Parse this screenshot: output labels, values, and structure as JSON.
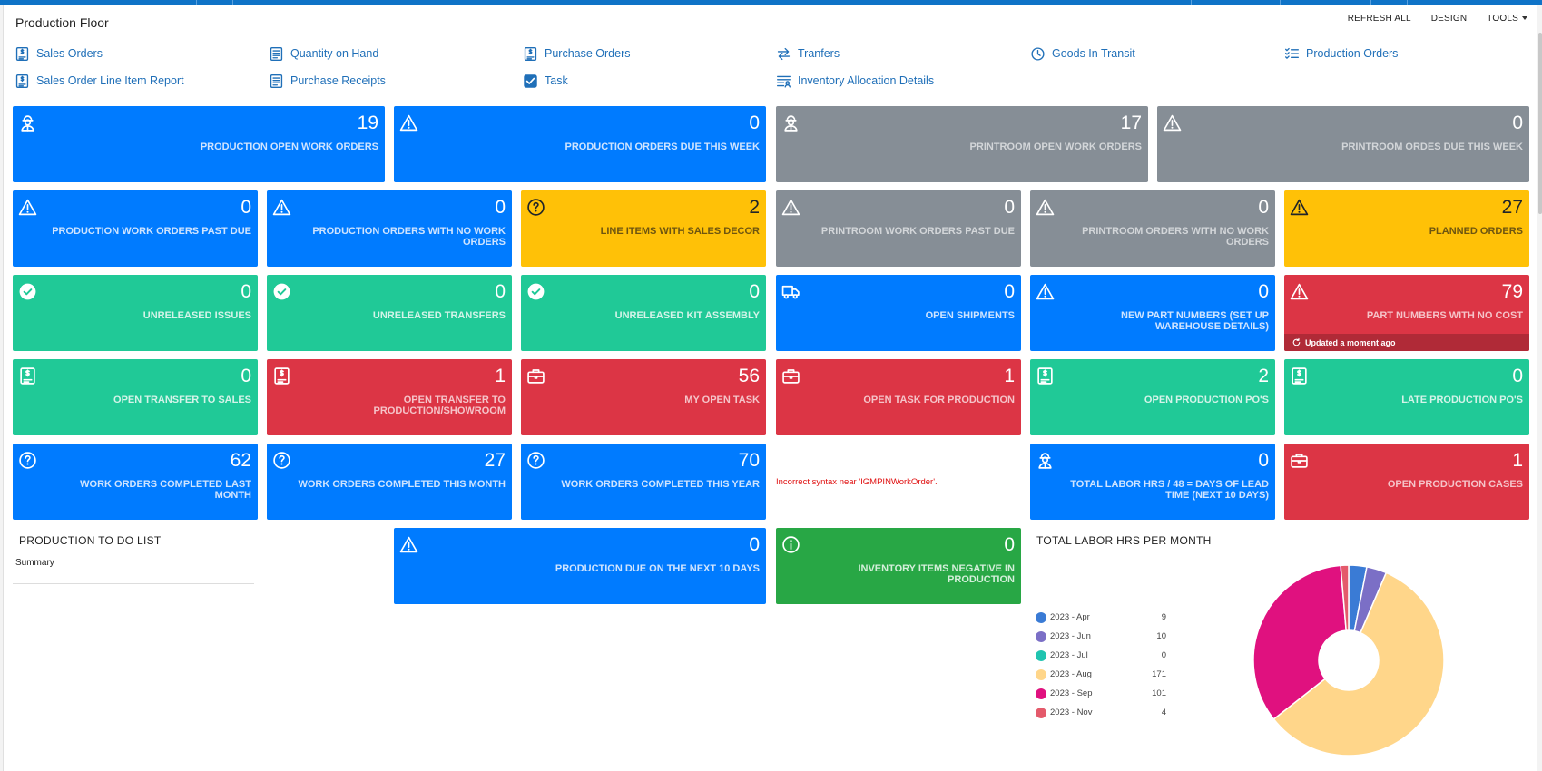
{
  "page": {
    "title": "Production Floor"
  },
  "toolbar": {
    "refresh": "REFRESH ALL",
    "design": "DESIGN",
    "tools": "TOOLS"
  },
  "links": [
    {
      "label": "Sales Orders",
      "icon": "document-dollar-icon"
    },
    {
      "label": "Quantity on Hand",
      "icon": "document-list-icon"
    },
    {
      "label": "Purchase Orders",
      "icon": "document-dollar-icon"
    },
    {
      "label": "Tranfers",
      "icon": "arrows-exchange-icon"
    },
    {
      "label": "Goods In Transit",
      "icon": "clock-icon"
    },
    {
      "label": "Production Orders",
      "icon": "checklist-icon"
    },
    {
      "label": "Sales Order Line Item Report",
      "icon": "document-dollar-icon"
    },
    {
      "label": "Purchase Receipts",
      "icon": "document-list-icon"
    },
    {
      "label": "Task",
      "icon": "checkbox-icon"
    },
    {
      "label": "Inventory Allocation Details",
      "icon": "list-user-icon"
    }
  ],
  "tiles": [
    {
      "value": "19",
      "label": "PRODUCTION OPEN WORK ORDERS",
      "color": "blue",
      "icon": "worker-icon"
    },
    {
      "value": "0",
      "label": "PRODUCTION ORDERS DUE THIS WEEK",
      "color": "blue",
      "icon": "warning-icon"
    },
    {
      "value": "17",
      "label": "PRINTROOM OPEN WORK ORDERS",
      "color": "gray",
      "icon": "worker-icon"
    },
    {
      "value": "0",
      "label": "PRINTROOM ORDES DUE THIS WEEK",
      "color": "gray",
      "icon": "warning-icon"
    },
    {
      "value": "0",
      "label": "PRODUCTION WORK ORDERS PAST DUE",
      "color": "blue",
      "icon": "warning-icon"
    },
    {
      "value": "0",
      "label": "PRODUCTION ORDERS WITH NO WORK ORDERS",
      "color": "blue",
      "icon": "warning-icon"
    },
    {
      "value": "2",
      "label": "LINE ITEMS WITH SALES DECOR",
      "color": "yellow",
      "icon": "question-icon"
    },
    {
      "value": "0",
      "label": "PRINTROOM WORK ORDERS PAST DUE",
      "color": "gray",
      "icon": "warning-icon"
    },
    {
      "value": "0",
      "label": "PRINTROOM ORDERS WITH NO WORK ORDERS",
      "color": "gray",
      "icon": "warning-icon"
    },
    {
      "value": "27",
      "label": "PLANNED ORDERS",
      "color": "yellow",
      "icon": "warning-icon"
    },
    {
      "value": "0",
      "label": "UNRELEASED ISSUES",
      "color": "teal",
      "icon": "check-circle-icon"
    },
    {
      "value": "0",
      "label": "UNRELEASED TRANSFERS",
      "color": "teal",
      "icon": "check-circle-icon"
    },
    {
      "value": "0",
      "label": "UNRELEASED KIT ASSEMBLY",
      "color": "teal",
      "icon": "check-circle-icon"
    },
    {
      "value": "0",
      "label": "OPEN SHIPMENTS",
      "color": "blue",
      "icon": "truck-icon"
    },
    {
      "value": "0",
      "label": "NEW PART NUMBERS (SET UP WAREHOUSE DETAILS)",
      "color": "blue",
      "icon": "warning-icon"
    },
    {
      "value": "79",
      "label": "PART NUMBERS WITH NO COST",
      "color": "red",
      "icon": "warning-icon",
      "footer": "Updated a moment ago"
    },
    {
      "value": "0",
      "label": "OPEN TRANSFER TO SALES",
      "color": "teal",
      "icon": "document-dollar-icon"
    },
    {
      "value": "1",
      "label": "OPEN TRANSFER TO PRODUCTION/SHOWROOM",
      "color": "red",
      "icon": "document-dollar-icon"
    },
    {
      "value": "56",
      "label": "MY OPEN TASK",
      "color": "red",
      "icon": "briefcase-icon"
    },
    {
      "value": "1",
      "label": "OPEN TASK FOR PRODUCTION",
      "color": "red",
      "icon": "briefcase-icon"
    },
    {
      "value": "2",
      "label": "OPEN PRODUCTION PO'S",
      "color": "teal",
      "icon": "document-dollar-icon"
    },
    {
      "value": "0",
      "label": "LATE PRODUCTION PO'S",
      "color": "teal",
      "icon": "document-dollar-icon"
    },
    {
      "value": "62",
      "label": "WORK ORDERS COMPLETED LAST MONTH",
      "color": "blue",
      "icon": "question-icon"
    },
    {
      "value": "27",
      "label": "WORK ORDERS COMPLETED THIS MONTH",
      "color": "blue",
      "icon": "question-icon"
    },
    {
      "value": "70",
      "label": "WORK ORDERS COMPLETED THIS YEAR",
      "color": "blue",
      "icon": "question-icon"
    },
    {
      "value": "0",
      "label": "TOTAL LABOR HRS / 48 = DAYS OF LEAD TIME (NEXT 10 DAYS)",
      "color": "blue",
      "icon": "worker-icon"
    },
    {
      "value": "1",
      "label": "OPEN PRODUCTION CASES",
      "color": "red",
      "icon": "briefcase-icon"
    },
    {
      "value": "0",
      "label": "PRODUCTION DUE ON THE NEXT 10 DAYS",
      "color": "blue",
      "icon": "warning-icon"
    },
    {
      "value": "0",
      "label": "INVENTORY ITEMS NEGATIVE IN PRODUCTION",
      "color": "green",
      "icon": "info-icon"
    }
  ],
  "error": {
    "text": "Incorrect syntax near 'IGMPINWorkOrder'."
  },
  "todo": {
    "title": "PRODUCTION TO DO LIST",
    "summary": "Summary"
  },
  "chart_data": {
    "type": "pie",
    "title": "TOTAL LABOR HRS PER MONTH",
    "donut": true,
    "legend_position": "left",
    "categories": [
      "2023 - Apr",
      "2023 - Jun",
      "2023 - Jul",
      "2023 - Aug",
      "2023 - Sep",
      "2023 - Nov"
    ],
    "values": [
      9,
      10,
      0,
      171,
      101,
      4
    ],
    "colors": [
      "#3a7bd5",
      "#7b6fc6",
      "#20c4b0",
      "#ffd68a",
      "#e0117f",
      "#e45a6b"
    ]
  }
}
